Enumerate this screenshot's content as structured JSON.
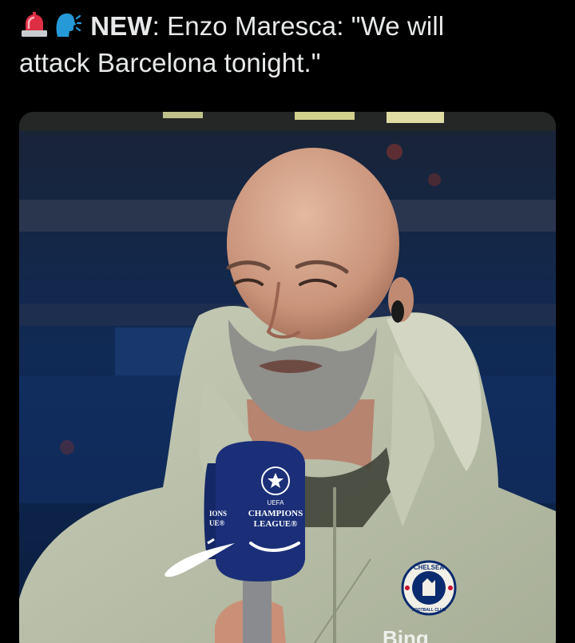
{
  "tweet": {
    "emojis": [
      "police-light-icon",
      "speaking-head-icon"
    ],
    "label": "NEW",
    "colon": ":",
    "line1_rest": " Enzo Maresca: \"We will",
    "line2": "attack Barcelona tonight.\""
  },
  "photo": {
    "mic_text": {
      "uefa": "UEFA",
      "line1": "CHAMPIONS",
      "line2": "LEAGUE®",
      "side_line1": "IONS",
      "side_line2": "UE®"
    },
    "badge": {
      "top": "CHELSEA",
      "bottom": "FOOTBALL CLUB"
    },
    "sponsor": "Bing"
  },
  "colors": {
    "background": "#000000",
    "text": "#e7e9ea",
    "jacket": "#b8bfa8",
    "mic": "#1b2f78",
    "stadium": "#0f2a55"
  }
}
